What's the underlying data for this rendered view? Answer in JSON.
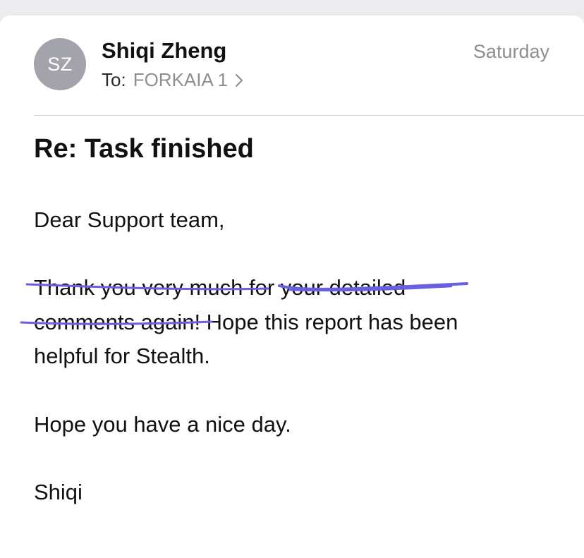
{
  "header": {
    "avatar_initials": "SZ",
    "sender_name": "Shiqi Zheng",
    "to_label": "To:",
    "recipient": "FORKAIA 1",
    "date": "Saturday"
  },
  "message": {
    "subject": "Re: Task finished",
    "body_lines": [
      "Dear Support team,",
      "Thank you very much for your detailed",
      "comments again! Hope this report has been",
      "helpful for Stealth.",
      "Hope you have a nice day.",
      "Shiqi"
    ]
  },
  "colors": {
    "avatar_bg": "#a3a3ab",
    "secondary_text": "#8e8e93",
    "annotation_ink": "#6a5fe0"
  },
  "icons": {
    "recipient_chevron": "chevron-right-icon"
  }
}
